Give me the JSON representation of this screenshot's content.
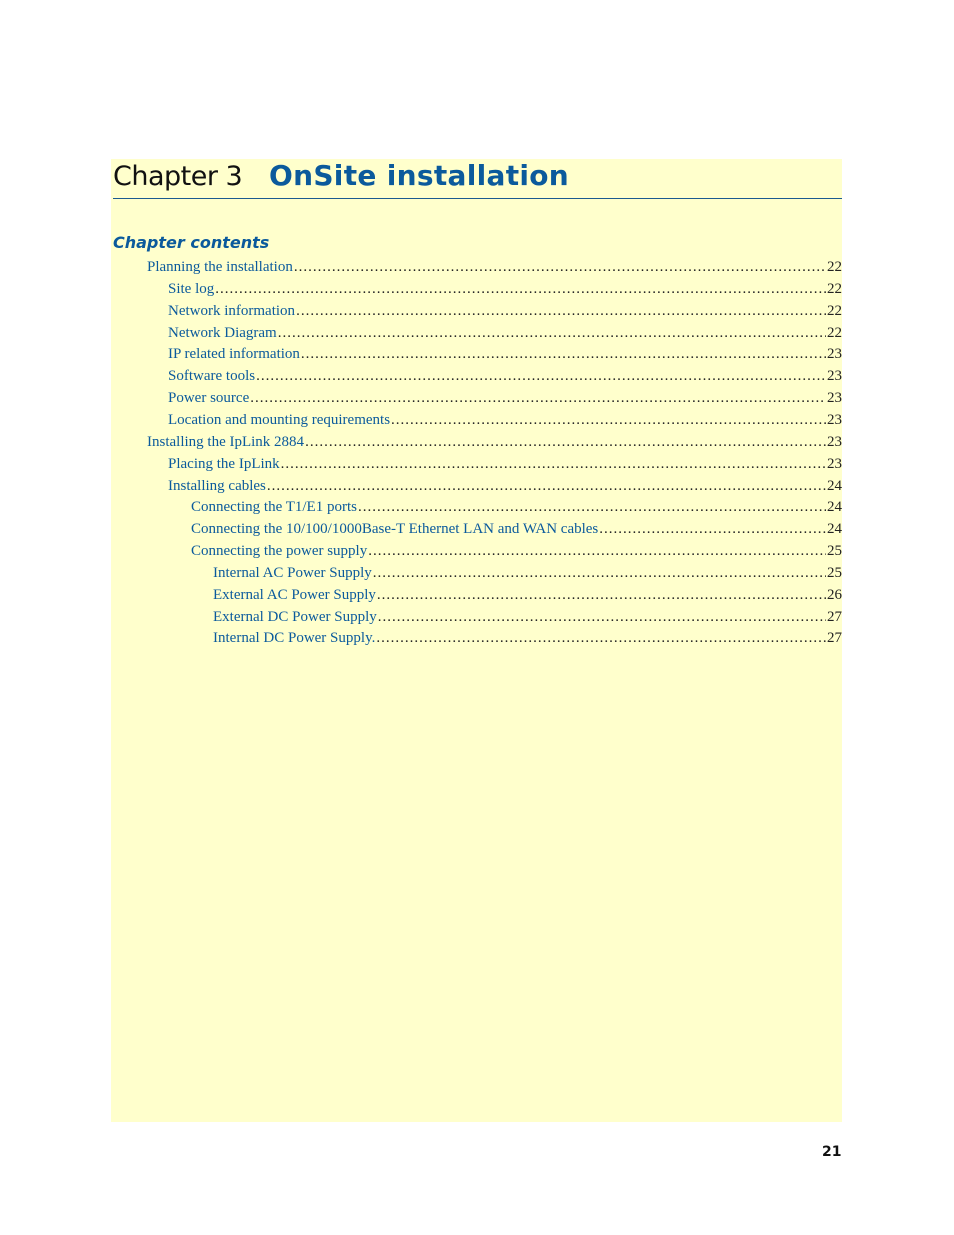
{
  "chapter": {
    "label": "Chapter 3",
    "title": "OnSite installation"
  },
  "contents_heading": "Chapter contents",
  "toc": [
    {
      "level": 1,
      "title": "Planning the installation",
      "page": "22"
    },
    {
      "level": 2,
      "title": "Site log",
      "page": "22"
    },
    {
      "level": 2,
      "title": "Network information",
      "page": "22"
    },
    {
      "level": 2,
      "title": "Network Diagram",
      "page": "22"
    },
    {
      "level": 2,
      "title": "IP related information",
      "page": "23"
    },
    {
      "level": 2,
      "title": "Software tools",
      "page": "23"
    },
    {
      "level": 2,
      "title": "Power source",
      "page": "23"
    },
    {
      "level": 2,
      "title": "Location and mounting requirements",
      "page": "23"
    },
    {
      "level": 1,
      "title": "Installing the IpLink 2884",
      "page": "23"
    },
    {
      "level": 2,
      "title": "Placing the IpLink",
      "page": "23"
    },
    {
      "level": 2,
      "title": "Installing cables",
      "page": "24"
    },
    {
      "level": 3,
      "title": "Connecting the T1/E1 ports",
      "page": "24"
    },
    {
      "level": 3,
      "title": "Connecting the 10/100/1000Base-T Ethernet LAN and WAN cables",
      "page": "24"
    },
    {
      "level": 3,
      "title": "Connecting the power supply",
      "page": "25"
    },
    {
      "level": 4,
      "title": "Internal AC Power Supply",
      "page": "25"
    },
    {
      "level": 4,
      "title": "External AC Power Supply",
      "page": "26"
    },
    {
      "level": 4,
      "title": "External DC Power Supply",
      "page": "27"
    },
    {
      "level": 4,
      "title": "Internal DC Power Supply.",
      "page": "27"
    }
  ],
  "footer": {
    "page_number": "21"
  },
  "colors": {
    "panel_background": "#ffffcc",
    "accent_blue": "#0b5a9c",
    "rule": "#1b5a8f"
  }
}
